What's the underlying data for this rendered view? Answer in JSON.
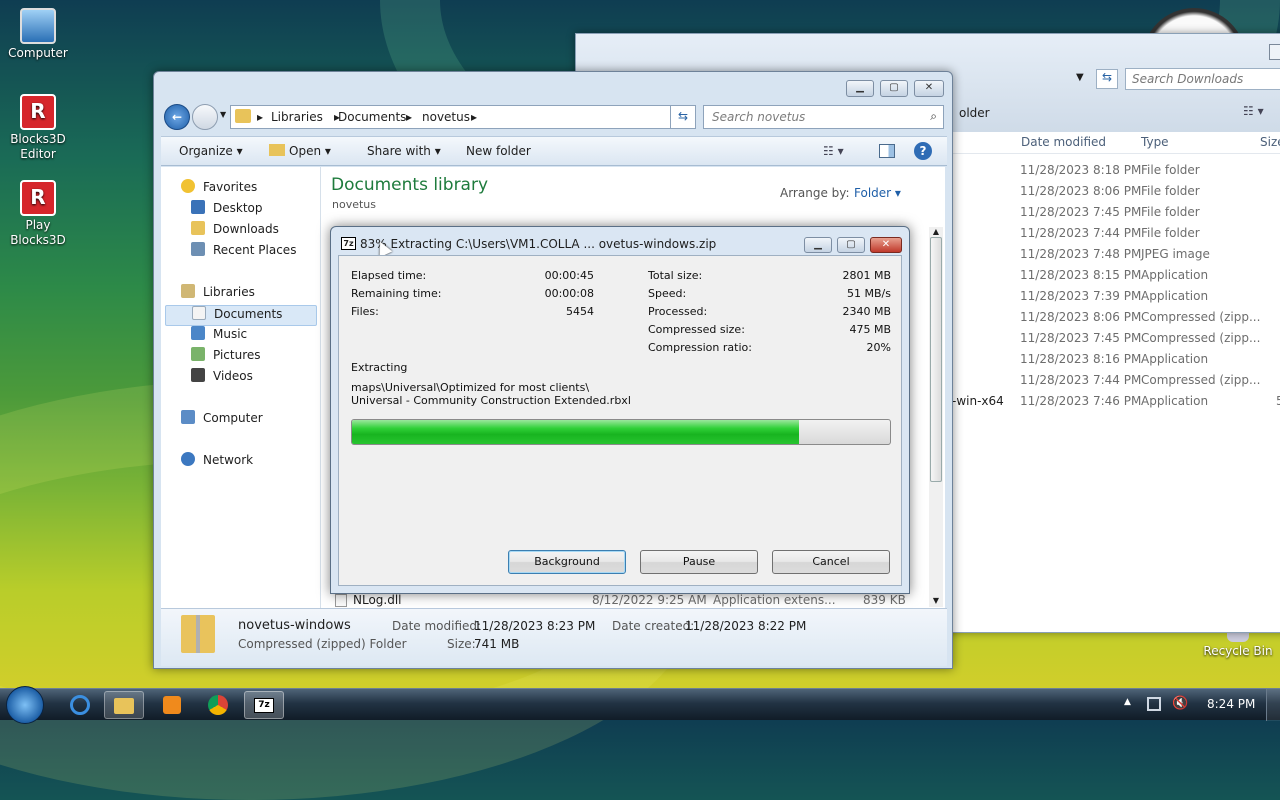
{
  "desktop": {
    "icons": [
      {
        "label": "Computer",
        "icon": "computer-icon"
      },
      {
        "label": "Blocks3D Editor",
        "icon": "blocks3d-icon"
      },
      {
        "label": "Play Blocks3D",
        "icon": "blocks3d-icon"
      },
      {
        "label": "Recycle Bin",
        "icon": "recycle-bin-icon"
      }
    ]
  },
  "bg_window": {
    "search_placeholder": "Search Downloads",
    "folder_fragment": "older",
    "columns": {
      "date": "Date modified",
      "type": "Type",
      "size": "Size"
    },
    "rows": [
      {
        "name": "",
        "date": "11/28/2023 8:18 PM",
        "type": "File folder",
        "size": ""
      },
      {
        "name": "",
        "date": "11/28/2023 8:06 PM",
        "type": "File folder",
        "size": ""
      },
      {
        "name": "",
        "date": "11/28/2023 7:45 PM",
        "type": "File folder",
        "size": ""
      },
      {
        "name": "",
        "date": "11/28/2023 7:44 PM",
        "type": "File folder",
        "size": ""
      },
      {
        "name": "",
        "date": "11/28/2023 7:48 PM",
        "type": "JPEG image",
        "size": ""
      },
      {
        "name": "",
        "date": "11/28/2023 8:15 PM",
        "type": "Application",
        "size": ""
      },
      {
        "name": "",
        "date": "11/28/2023 7:39 PM",
        "type": "Application",
        "size": ""
      },
      {
        "name": "",
        "date": "11/28/2023 8:06 PM",
        "type": "Compressed (zipp...",
        "size": ""
      },
      {
        "name": "",
        "date": "11/28/2023 7:45 PM",
        "type": "Compressed (zipp...",
        "size": ""
      },
      {
        "name": "",
        "date": "11/28/2023 8:16 PM",
        "type": "Application",
        "size": ""
      },
      {
        "name": "",
        "date": "11/28/2023 7:44 PM",
        "type": "Compressed (zipp...",
        "size": ""
      },
      {
        "name": "-win-x64",
        "date": "11/28/2023 7:46 PM",
        "type": "Application",
        "size": "5"
      }
    ]
  },
  "explorer": {
    "breadcrumb": [
      "Libraries",
      "Documents",
      "novetus"
    ],
    "search_placeholder": "Search novetus",
    "toolbar": {
      "organize": "Organize",
      "open": "Open",
      "share": "Share with",
      "new_folder": "New folder"
    },
    "nav": {
      "favorites": "Favorites",
      "fav_items": [
        "Desktop",
        "Downloads",
        "Recent Places"
      ],
      "libraries": "Libraries",
      "lib_items": [
        "Documents",
        "Music",
        "Pictures",
        "Videos"
      ],
      "computer": "Computer",
      "network": "Network"
    },
    "library_title": "Documents library",
    "library_sub": "novetus",
    "arrange_label": "Arrange by:",
    "arrange_value": "Folder",
    "visible_file": {
      "name": "NLog.dll",
      "date": "8/12/2022 9:25 AM",
      "type": "Application extens...",
      "size": "839 KB"
    },
    "details": {
      "name": "novetus-windows",
      "type": "Compressed (zipped) Folder",
      "modified_label": "Date modified:",
      "modified": "11/28/2023 8:23 PM",
      "created_label": "Date created:",
      "created": "11/28/2023 8:22 PM",
      "size_label": "Size:",
      "size": "741 MB"
    }
  },
  "dialog": {
    "title": "83% Extracting C:\\Users\\VM1.COLLA ... ovetus-windows.zip",
    "stats_left": [
      {
        "label": "Elapsed time:",
        "value": "00:00:45"
      },
      {
        "label": "Remaining time:",
        "value": "00:00:08"
      },
      {
        "label": "Files:",
        "value": "5454"
      }
    ],
    "stats_right": [
      {
        "label": "Total size:",
        "value": "2801 MB"
      },
      {
        "label": "Speed:",
        "value": "51 MB/s"
      },
      {
        "label": "Processed:",
        "value": "2340 MB"
      },
      {
        "label": "Compressed size:",
        "value": "475 MB"
      },
      {
        "label": "Compression ratio:",
        "value": "20%"
      }
    ],
    "action": "Extracting",
    "path_line1": "maps\\Universal\\Optimized for most clients\\",
    "path_line2": "Universal - Community Construction Extended.rbxl",
    "progress": 0.83,
    "buttons": {
      "background": "Background",
      "pause": "Pause",
      "cancel": "Cancel"
    },
    "app_icon_text": "7z"
  },
  "taskbar": {
    "clock": "8:24 PM",
    "colors": {
      "progress_green": "#22c32a",
      "explorer_title": "#1e7b3c"
    }
  }
}
